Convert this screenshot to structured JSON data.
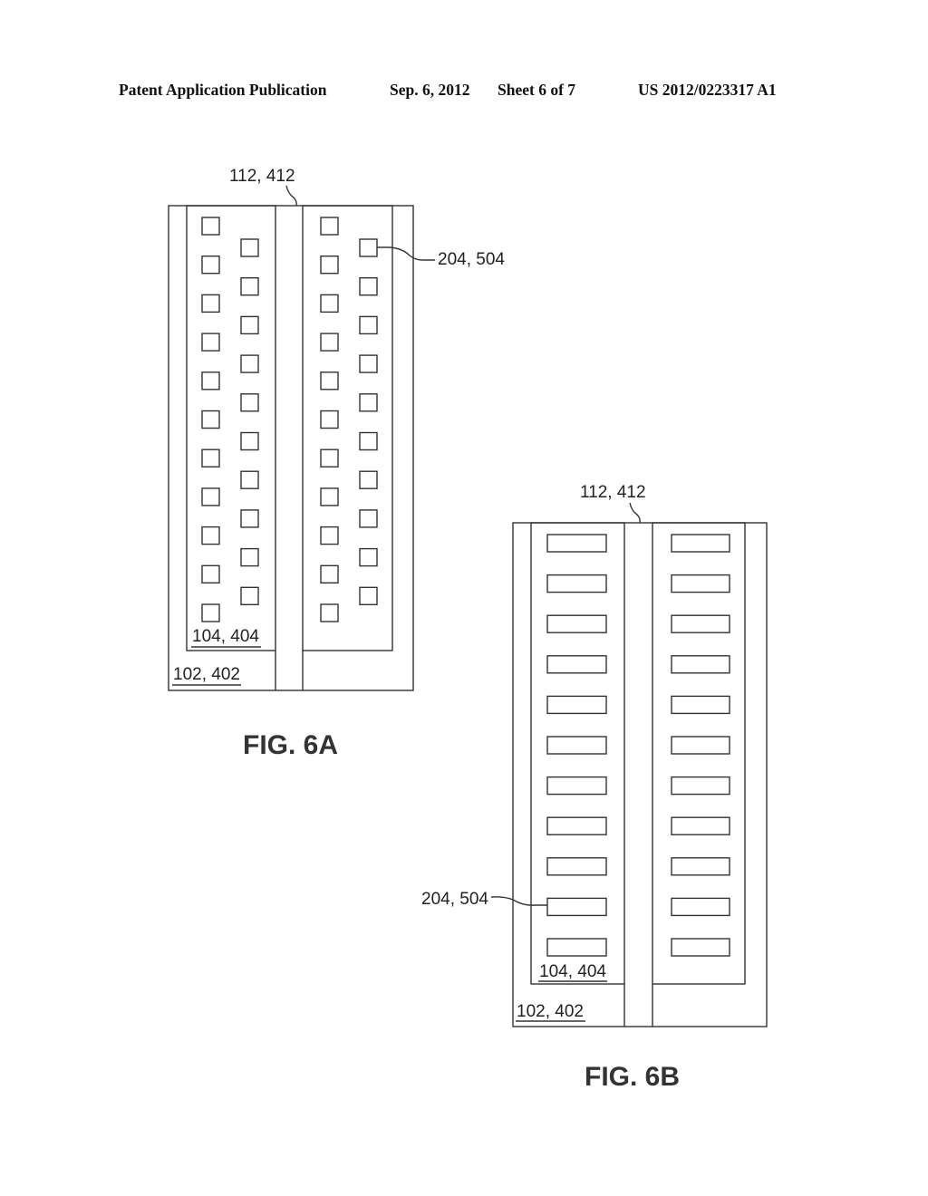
{
  "header": {
    "publication": "Patent Application Publication",
    "date": "Sep. 6, 2012",
    "sheet": "Sheet 6 of 7",
    "number": "US 2012/0223317 A1"
  },
  "figures": [
    {
      "id": "6A",
      "caption": "FIG. 6A",
      "element_shape": "square",
      "labels": {
        "top": "112, 412",
        "element": "204, 504",
        "inner": "104, 404",
        "outer": "102, 402"
      },
      "rows_outer_column": 11,
      "rows_inner_column": 10
    },
    {
      "id": "6B",
      "caption": "FIG. 6B",
      "element_shape": "rectangle",
      "labels": {
        "top": "112, 412",
        "element": "204, 504",
        "inner": "104, 404",
        "outer": "102, 402"
      },
      "rows": 11
    }
  ]
}
